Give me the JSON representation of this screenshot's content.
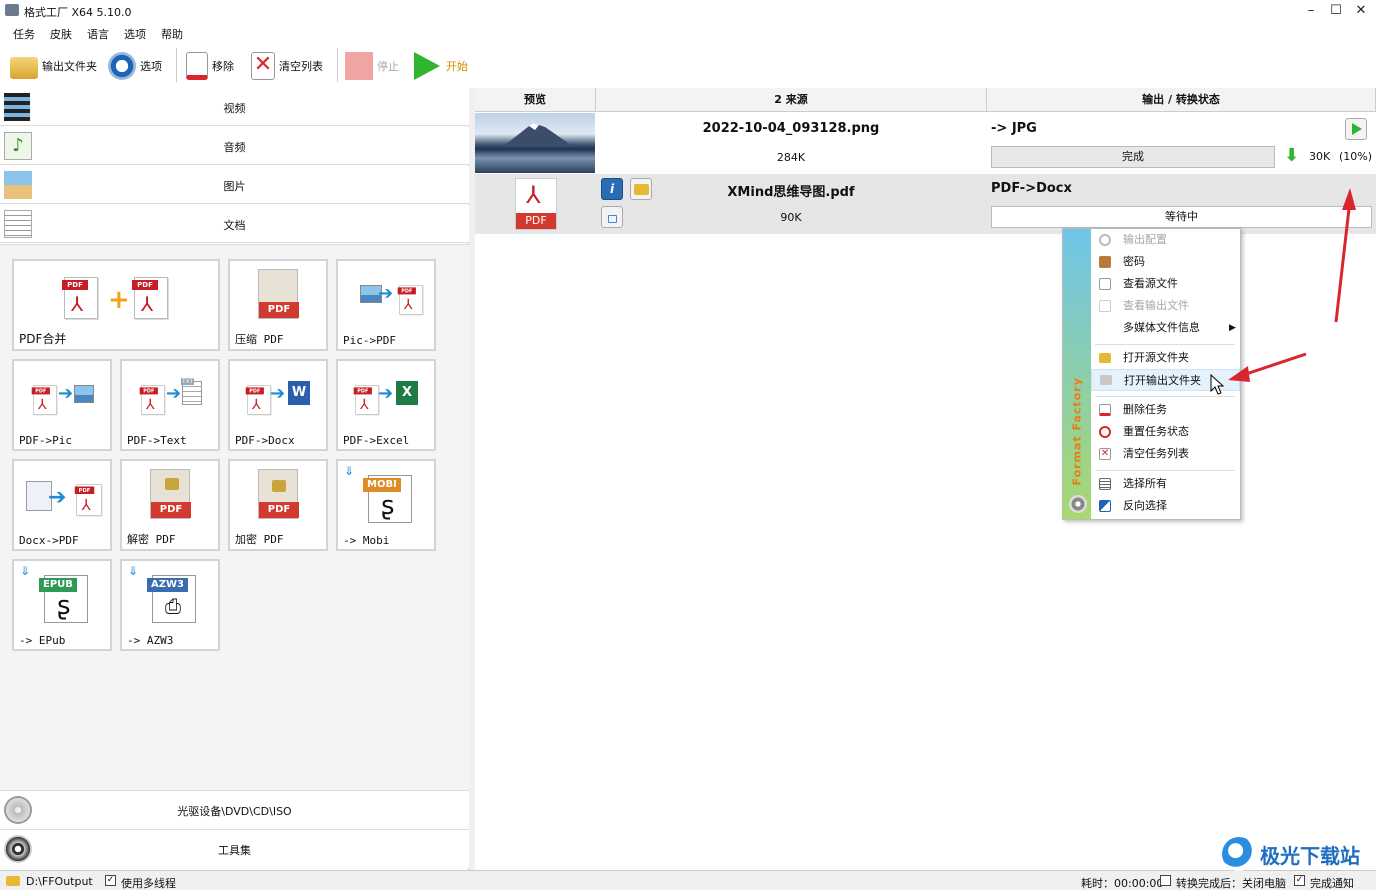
{
  "window": {
    "title": "格式工厂 X64 5.10.0",
    "minimize": "–",
    "maximize": "☐",
    "close": "✕"
  },
  "menu": [
    "任务",
    "皮肤",
    "语言",
    "选项",
    "帮助"
  ],
  "toolbar": {
    "output_folder": "输出文件夹",
    "options": "选项",
    "remove": "移除",
    "clear_list": "清空列表",
    "stop": "停止",
    "start": "开始"
  },
  "categories": {
    "video": "视频",
    "audio": "音频",
    "image": "图片",
    "document": "文档",
    "optical": "光驱设备\\DVD\\CD\\ISO",
    "tools": "工具集"
  },
  "tiles": [
    {
      "label": "PDF合并"
    },
    {
      "label": "压缩 PDF"
    },
    {
      "label": "Pic->PDF"
    },
    {
      "label": "PDF->Pic"
    },
    {
      "label": "PDF->Text"
    },
    {
      "label": "PDF->Docx"
    },
    {
      "label": "PDF->Excel"
    },
    {
      "label": "Docx->PDF"
    },
    {
      "label": "解密 PDF"
    },
    {
      "label": "加密 PDF"
    },
    {
      "label": "-> Mobi"
    },
    {
      "label": "-> EPub"
    },
    {
      "label": "-> AZW3"
    }
  ],
  "tile_badges": {
    "pdf": "PDF",
    "txt": "TXT",
    "mobi": "MOBI",
    "epub": "EPUB",
    "azw3": "AZW3"
  },
  "columns": {
    "preview": "预览",
    "source": "2 来源",
    "output": "输出 / 转换状态"
  },
  "tasks": [
    {
      "file": "2022-10-04_093128.png",
      "size": "284K",
      "target": "-> JPG",
      "state": "完成",
      "out_size": "30K",
      "ratio": "(10%)"
    },
    {
      "file": "XMind思维导图.pdf",
      "size": "90K",
      "target": "PDF->Docx",
      "state": "等待中",
      "preview_badge": "PDF"
    }
  ],
  "context_menu": {
    "brand": "Format Factory",
    "items": [
      {
        "label": "输出配置",
        "disabled": true
      },
      {
        "label": "密码",
        "disabled": false
      },
      {
        "label": "查看源文件",
        "disabled": false
      },
      {
        "label": "查看输出文件",
        "disabled": true
      },
      {
        "label": "多媒体文件信息",
        "disabled": false
      },
      {
        "label": "打开源文件夹",
        "disabled": false
      },
      {
        "label": "打开输出文件夹",
        "disabled": false
      },
      {
        "label": "删除任务",
        "disabled": false
      },
      {
        "label": "重置任务状态",
        "disabled": false
      },
      {
        "label": "清空任务列表",
        "disabled": false
      },
      {
        "label": "选择所有",
        "disabled": false
      },
      {
        "label": "反向选择",
        "disabled": false
      }
    ]
  },
  "statusbar": {
    "output_path": "D:\\FFOutput",
    "multithread": "使用多线程",
    "elapsed": "耗时：00:00:00",
    "after_convert": "转换完成后：关闭电脑",
    "notify": "完成通知"
  },
  "watermark": "极光下载站",
  "colors": {
    "accent_red": "#d9262c",
    "start_green": "#2fb52f",
    "menu_stripe_top": "#6fc5e8",
    "menu_stripe_bottom": "#a9d86e"
  }
}
